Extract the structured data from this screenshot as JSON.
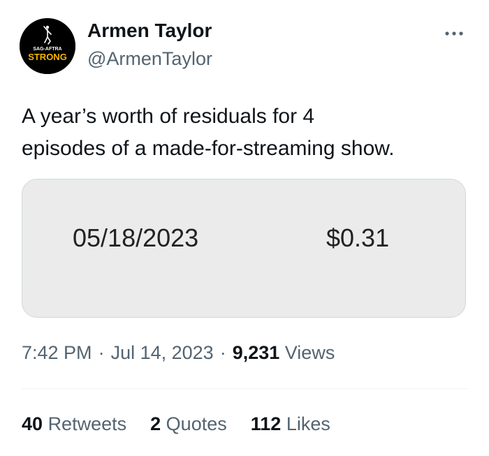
{
  "user": {
    "display_name": "Armen Taylor",
    "handle": "@ArmenTaylor",
    "avatar": {
      "top_text": "SAG-AFTRA",
      "badge_text": "STRONG",
      "background_color": "#000000",
      "badge_color": "#f4b400"
    }
  },
  "menu": {
    "icon": "more-icon"
  },
  "tweet": {
    "text_line1": "A year’s worth of residuals for 4",
    "text_line2": "episodes of a made-for-streaming show."
  },
  "media": {
    "date": "05/18/2023",
    "amount": "$0.31"
  },
  "meta": {
    "time": "7:42 PM",
    "separator": "·",
    "date": "Jul 14, 2023",
    "views_count": "9,231",
    "views_label": "Views"
  },
  "stats": {
    "retweets_count": "40",
    "retweets_label": "Retweets",
    "quotes_count": "2",
    "quotes_label": "Quotes",
    "likes_count": "112",
    "likes_label": "Likes"
  },
  "colors": {
    "primary_text": "#0f1419",
    "secondary_text": "#536471",
    "media_background": "#ebebeb",
    "border": "#cfd9de"
  }
}
